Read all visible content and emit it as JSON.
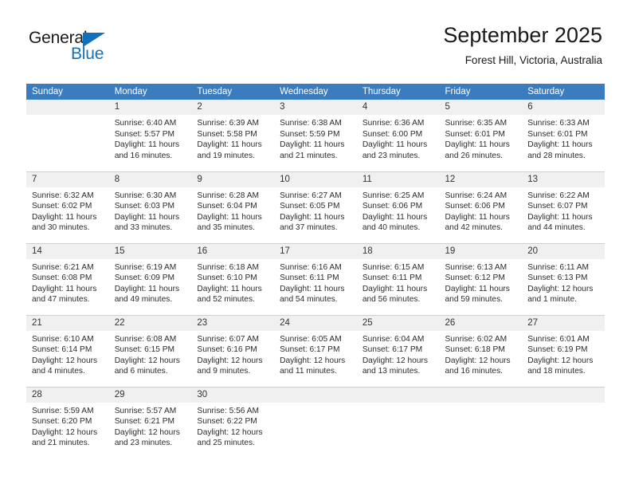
{
  "logo": {
    "word_one": "General",
    "word_two": "Blue",
    "triangle_color": "#1271bd"
  },
  "header": {
    "title": "September 2025",
    "location": "Forest Hill, Victoria, Australia"
  },
  "theme": {
    "header_blue": "#3a7cbe",
    "daynum_bg": "#f0f0f0",
    "grid_line": "#cfcfcf"
  },
  "weekday_headers": [
    "Sunday",
    "Monday",
    "Tuesday",
    "Wednesday",
    "Thursday",
    "Friday",
    "Saturday"
  ],
  "weeks": [
    [
      {
        "day": "",
        "sunrise": "",
        "sunset": "",
        "daylight": "",
        "empty": true
      },
      {
        "day": "1",
        "sunrise": "Sunrise: 6:40 AM",
        "sunset": "Sunset: 5:57 PM",
        "daylight": "Daylight: 11 hours and 16 minutes."
      },
      {
        "day": "2",
        "sunrise": "Sunrise: 6:39 AM",
        "sunset": "Sunset: 5:58 PM",
        "daylight": "Daylight: 11 hours and 19 minutes."
      },
      {
        "day": "3",
        "sunrise": "Sunrise: 6:38 AM",
        "sunset": "Sunset: 5:59 PM",
        "daylight": "Daylight: 11 hours and 21 minutes."
      },
      {
        "day": "4",
        "sunrise": "Sunrise: 6:36 AM",
        "sunset": "Sunset: 6:00 PM",
        "daylight": "Daylight: 11 hours and 23 minutes."
      },
      {
        "day": "5",
        "sunrise": "Sunrise: 6:35 AM",
        "sunset": "Sunset: 6:01 PM",
        "daylight": "Daylight: 11 hours and 26 minutes."
      },
      {
        "day": "6",
        "sunrise": "Sunrise: 6:33 AM",
        "sunset": "Sunset: 6:01 PM",
        "daylight": "Daylight: 11 hours and 28 minutes."
      }
    ],
    [
      {
        "day": "7",
        "sunrise": "Sunrise: 6:32 AM",
        "sunset": "Sunset: 6:02 PM",
        "daylight": "Daylight: 11 hours and 30 minutes."
      },
      {
        "day": "8",
        "sunrise": "Sunrise: 6:30 AM",
        "sunset": "Sunset: 6:03 PM",
        "daylight": "Daylight: 11 hours and 33 minutes."
      },
      {
        "day": "9",
        "sunrise": "Sunrise: 6:28 AM",
        "sunset": "Sunset: 6:04 PM",
        "daylight": "Daylight: 11 hours and 35 minutes."
      },
      {
        "day": "10",
        "sunrise": "Sunrise: 6:27 AM",
        "sunset": "Sunset: 6:05 PM",
        "daylight": "Daylight: 11 hours and 37 minutes."
      },
      {
        "day": "11",
        "sunrise": "Sunrise: 6:25 AM",
        "sunset": "Sunset: 6:06 PM",
        "daylight": "Daylight: 11 hours and 40 minutes."
      },
      {
        "day": "12",
        "sunrise": "Sunrise: 6:24 AM",
        "sunset": "Sunset: 6:06 PM",
        "daylight": "Daylight: 11 hours and 42 minutes."
      },
      {
        "day": "13",
        "sunrise": "Sunrise: 6:22 AM",
        "sunset": "Sunset: 6:07 PM",
        "daylight": "Daylight: 11 hours and 44 minutes."
      }
    ],
    [
      {
        "day": "14",
        "sunrise": "Sunrise: 6:21 AM",
        "sunset": "Sunset: 6:08 PM",
        "daylight": "Daylight: 11 hours and 47 minutes."
      },
      {
        "day": "15",
        "sunrise": "Sunrise: 6:19 AM",
        "sunset": "Sunset: 6:09 PM",
        "daylight": "Daylight: 11 hours and 49 minutes."
      },
      {
        "day": "16",
        "sunrise": "Sunrise: 6:18 AM",
        "sunset": "Sunset: 6:10 PM",
        "daylight": "Daylight: 11 hours and 52 minutes."
      },
      {
        "day": "17",
        "sunrise": "Sunrise: 6:16 AM",
        "sunset": "Sunset: 6:11 PM",
        "daylight": "Daylight: 11 hours and 54 minutes."
      },
      {
        "day": "18",
        "sunrise": "Sunrise: 6:15 AM",
        "sunset": "Sunset: 6:11 PM",
        "daylight": "Daylight: 11 hours and 56 minutes."
      },
      {
        "day": "19",
        "sunrise": "Sunrise: 6:13 AM",
        "sunset": "Sunset: 6:12 PM",
        "daylight": "Daylight: 11 hours and 59 minutes."
      },
      {
        "day": "20",
        "sunrise": "Sunrise: 6:11 AM",
        "sunset": "Sunset: 6:13 PM",
        "daylight": "Daylight: 12 hours and 1 minute."
      }
    ],
    [
      {
        "day": "21",
        "sunrise": "Sunrise: 6:10 AM",
        "sunset": "Sunset: 6:14 PM",
        "daylight": "Daylight: 12 hours and 4 minutes."
      },
      {
        "day": "22",
        "sunrise": "Sunrise: 6:08 AM",
        "sunset": "Sunset: 6:15 PM",
        "daylight": "Daylight: 12 hours and 6 minutes."
      },
      {
        "day": "23",
        "sunrise": "Sunrise: 6:07 AM",
        "sunset": "Sunset: 6:16 PM",
        "daylight": "Daylight: 12 hours and 9 minutes."
      },
      {
        "day": "24",
        "sunrise": "Sunrise: 6:05 AM",
        "sunset": "Sunset: 6:17 PM",
        "daylight": "Daylight: 12 hours and 11 minutes."
      },
      {
        "day": "25",
        "sunrise": "Sunrise: 6:04 AM",
        "sunset": "Sunset: 6:17 PM",
        "daylight": "Daylight: 12 hours and 13 minutes."
      },
      {
        "day": "26",
        "sunrise": "Sunrise: 6:02 AM",
        "sunset": "Sunset: 6:18 PM",
        "daylight": "Daylight: 12 hours and 16 minutes."
      },
      {
        "day": "27",
        "sunrise": "Sunrise: 6:01 AM",
        "sunset": "Sunset: 6:19 PM",
        "daylight": "Daylight: 12 hours and 18 minutes."
      }
    ],
    [
      {
        "day": "28",
        "sunrise": "Sunrise: 5:59 AM",
        "sunset": "Sunset: 6:20 PM",
        "daylight": "Daylight: 12 hours and 21 minutes."
      },
      {
        "day": "29",
        "sunrise": "Sunrise: 5:57 AM",
        "sunset": "Sunset: 6:21 PM",
        "daylight": "Daylight: 12 hours and 23 minutes."
      },
      {
        "day": "30",
        "sunrise": "Sunrise: 5:56 AM",
        "sunset": "Sunset: 6:22 PM",
        "daylight": "Daylight: 12 hours and 25 minutes."
      },
      {
        "day": "",
        "sunrise": "",
        "sunset": "",
        "daylight": "",
        "empty": true
      },
      {
        "day": "",
        "sunrise": "",
        "sunset": "",
        "daylight": "",
        "empty": true
      },
      {
        "day": "",
        "sunrise": "",
        "sunset": "",
        "daylight": "",
        "empty": true
      },
      {
        "day": "",
        "sunrise": "",
        "sunset": "",
        "daylight": "",
        "empty": true
      }
    ]
  ]
}
